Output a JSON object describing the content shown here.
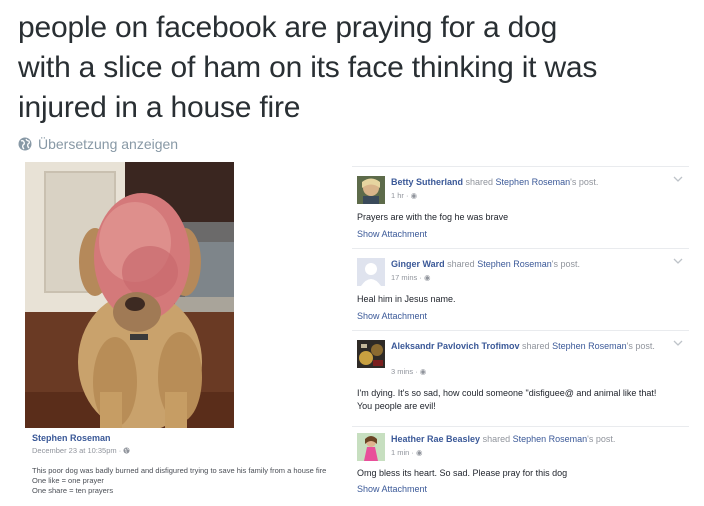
{
  "tweet": {
    "line1": "people on facebook are praying for a dog",
    "line2": "with a slice of ham on its face thinking it was",
    "line3": "injured in a house fire",
    "translate_label": "Übersetzung anzeigen"
  },
  "post": {
    "author": "Stephen Roseman",
    "date": "December 23 at 10:35pm · ",
    "body_line1": "This poor dog was badly burned and disfigured trying to save his family from a house fire",
    "body_line2": "One like = one prayer",
    "body_line3": "One share = ten prayers"
  },
  "comments": [
    {
      "name": "Betty Sutherland",
      "shared": " shared ",
      "target": "Stephen Roseman",
      "suffix": "'s post.",
      "time": "1 hr · ",
      "text": "Prayers are with the fog he was brave",
      "attachment": "Show Attachment"
    },
    {
      "name": "Ginger Ward",
      "shared": " shared ",
      "target": "Stephen Roseman",
      "suffix": "'s post.",
      "time": "17 mins · ",
      "text": "Heal him in Jesus name.",
      "attachment": "Show Attachment"
    },
    {
      "name": "Aleksandr Pavlovich Trofimov",
      "shared": " shared ",
      "target": "Stephen Roseman",
      "suffix": "'s post.",
      "time": "3 mins · ",
      "text_line1": "I'm dying. It's so sad, how could someone \"disfiguee@ and animal like that!",
      "text_line2": "You people are evil!"
    },
    {
      "name": "Heather Rae Beasley",
      "shared": " shared ",
      "target": "Stephen Roseman",
      "suffix": "'s post.",
      "time": "1 min · ",
      "text": "Omg bless its heart. So sad. Please pray for this dog",
      "attachment": "Show Attachment"
    }
  ],
  "colors": {
    "facebook_link": "#3b5998",
    "meta_gray": "#90949c",
    "tweet_text": "#292f33"
  },
  "icons": [
    "globe-icon",
    "public-globe-icon",
    "chevron-down-icon"
  ]
}
